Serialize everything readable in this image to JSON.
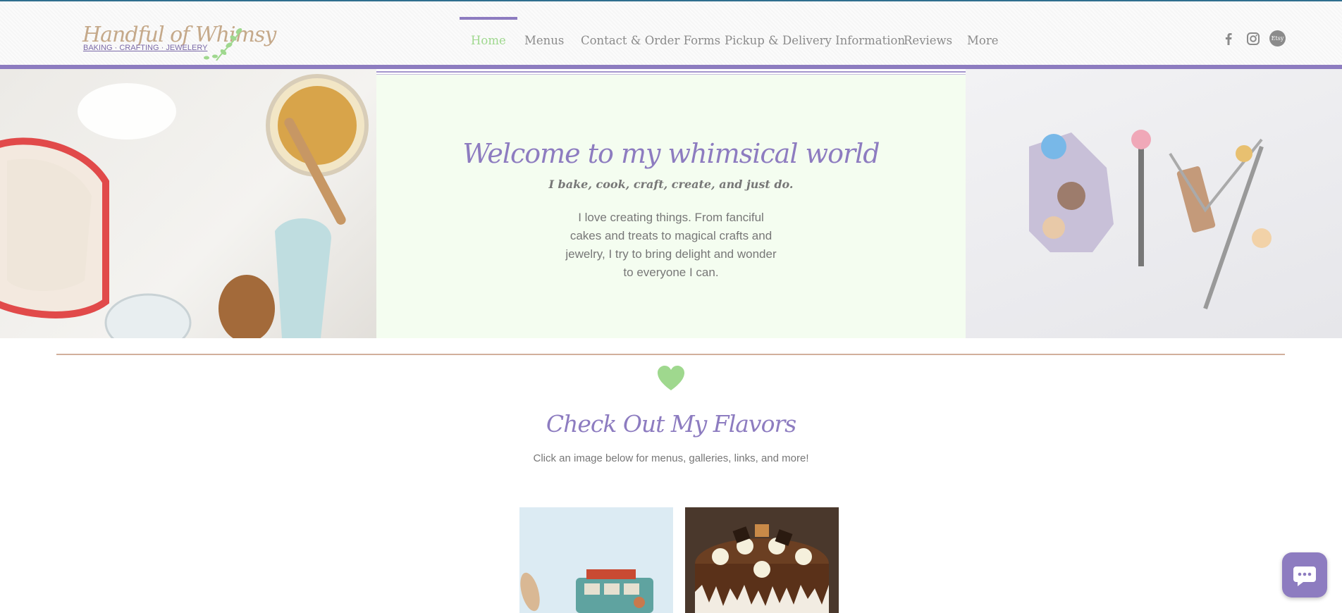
{
  "header": {
    "logo_title": "Handful of Whimsy",
    "logo_subtitle": "BAKING · CRAFTING · JEWELERY",
    "nav": [
      {
        "label": "Home",
        "active": true
      },
      {
        "label": "Menus"
      },
      {
        "label": "Contact & Order Forms"
      },
      {
        "label": "Pickup & Delivery Information"
      },
      {
        "label": "Reviews"
      },
      {
        "label": "More"
      }
    ],
    "social": [
      {
        "icon": "facebook-icon"
      },
      {
        "icon": "instagram-icon"
      },
      {
        "icon": "etsy-icon",
        "label": "Etsy"
      }
    ]
  },
  "hero": {
    "title": "Welcome to my whimsical world",
    "tagline": "I bake, cook, craft, create, and just do.",
    "intro": "I love creating things. From fanciful cakes and treats to magical crafts and jewelry, I try to bring delight and wonder to everyone I can."
  },
  "flavors": {
    "title": "Check Out My Flavors",
    "subtitle": "Click an image below for menus, galleries, links, and more!"
  },
  "colors": {
    "accent_purple": "#8d7cc0",
    "accent_green": "#9fd88e",
    "divider": "#d2b09c",
    "hero_bg": "#f4fdf0"
  }
}
